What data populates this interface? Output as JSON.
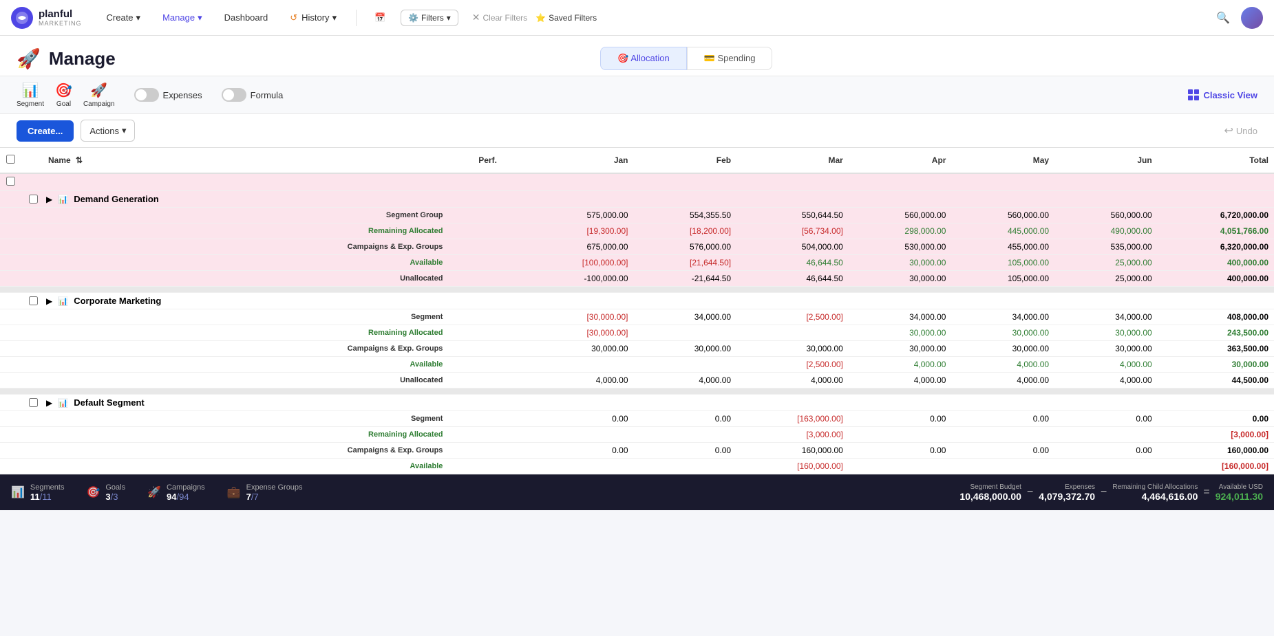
{
  "app": {
    "name": "planful",
    "subtitle": "MARKETING"
  },
  "nav": {
    "items": [
      {
        "label": "Create",
        "hasDropdown": true
      },
      {
        "label": "Manage",
        "hasDropdown": true
      },
      {
        "label": "Dashboard",
        "hasDropdown": false
      },
      {
        "label": "History",
        "hasDropdown": true,
        "icon": "history"
      }
    ],
    "filters_label": "Filters",
    "clear_filters": "Clear Filters",
    "saved_filters": "Saved Filters"
  },
  "page": {
    "title": "Manage",
    "tabs": [
      {
        "label": "Allocation",
        "icon": "🎯",
        "active": true
      },
      {
        "label": "Spending",
        "icon": "💰",
        "active": false
      }
    ]
  },
  "toolbar": {
    "segments_label": "Segment",
    "goals_label": "Goal",
    "campaigns_label": "Campaign",
    "expenses_label": "Expenses",
    "formula_label": "Formula",
    "classic_view": "Classic View"
  },
  "actions": {
    "create_label": "Create...",
    "actions_label": "Actions",
    "undo_label": "Undo"
  },
  "table": {
    "columns": [
      "Name",
      "Perf.",
      "Jan",
      "Feb",
      "Mar",
      "Apr",
      "May",
      "Jun",
      "Total"
    ],
    "rows": [
      {
        "group": "demand_generation",
        "name": "Demand Generation",
        "color": "pink",
        "sub_rows": [
          {
            "type": "segment_group",
            "label": "Segment Group",
            "jan": "575,000.00",
            "feb": "554,355.50",
            "mar": "550,644.50",
            "apr": "560,000.00",
            "may": "560,000.00",
            "jun": "560,000.00",
            "total": "6,720,000.00"
          },
          {
            "type": "remaining_allocated",
            "label": "Remaining Allocated",
            "jan": "[19,300.00]",
            "feb": "[18,200.00]",
            "mar": "[56,734.00]",
            "apr": "298,000.00",
            "may": "445,000.00",
            "jun": "490,000.00",
            "total": "4,051,766.00",
            "jan_color": "red",
            "feb_color": "red",
            "mar_color": "red",
            "apr_color": "green",
            "may_color": "green",
            "jun_color": "green",
            "total_color": "green"
          },
          {
            "type": "campaigns",
            "label": "Campaigns & Exp. Groups",
            "jan": "675,000.00",
            "feb": "576,000.00",
            "mar": "504,000.00",
            "apr": "530,000.00",
            "may": "455,000.00",
            "jun": "535,000.00",
            "total": "6,320,000.00"
          },
          {
            "type": "available",
            "label": "Available",
            "jan": "[100,000.00]",
            "feb": "[21,644.50]",
            "mar": "46,644.50",
            "apr": "30,000.00",
            "may": "105,000.00",
            "jun": "25,000.00",
            "total": "400,000.00",
            "jan_color": "red",
            "feb_color": "red",
            "mar_color": "green",
            "apr_color": "green",
            "may_color": "green",
            "jun_color": "green",
            "total_color": "green"
          },
          {
            "type": "unallocated",
            "label": "Unallocated",
            "jan": "-100,000.00",
            "feb": "-21,644.50",
            "mar": "46,644.50",
            "apr": "30,000.00",
            "may": "105,000.00",
            "jun": "25,000.00",
            "total": "400,000.00"
          }
        ]
      },
      {
        "group": "corporate_marketing",
        "name": "Corporate Marketing",
        "color": "white",
        "sub_rows": [
          {
            "type": "segment",
            "label": "Segment",
            "jan": "[30,000.00]",
            "feb": "34,000.00",
            "mar": "[2,500.00]",
            "apr": "34,000.00",
            "may": "34,000.00",
            "jun": "34,000.00",
            "total": "408,000.00",
            "jan_color": "red",
            "mar_color": "red"
          },
          {
            "type": "remaining_allocated",
            "label": "Remaining Allocated",
            "jan": "[30,000.00]",
            "feb": "",
            "mar": "",
            "apr": "30,000.00",
            "may": "30,000.00",
            "jun": "30,000.00",
            "total": "243,500.00",
            "jan_color": "red",
            "apr_color": "green",
            "may_color": "green",
            "jun_color": "green",
            "total_color": "green"
          },
          {
            "type": "campaigns",
            "label": "Campaigns & Exp. Groups",
            "jan": "30,000.00",
            "feb": "30,000.00",
            "mar": "30,000.00",
            "apr": "30,000.00",
            "may": "30,000.00",
            "jun": "30,000.00",
            "total": "363,500.00"
          },
          {
            "type": "available",
            "label": "Available",
            "jan": "",
            "feb": "",
            "mar": "[2,500.00]",
            "apr": "4,000.00",
            "may": "4,000.00",
            "jun": "4,000.00",
            "total": "30,000.00",
            "mar_color": "red",
            "apr_color": "green",
            "may_color": "green",
            "jun_color": "green",
            "total_color": "green"
          },
          {
            "type": "unallocated",
            "label": "Unallocated",
            "jan": "4,000.00",
            "feb": "4,000.00",
            "mar": "4,000.00",
            "apr": "4,000.00",
            "may": "4,000.00",
            "jun": "4,000.00",
            "total": "44,500.00"
          }
        ]
      },
      {
        "group": "default_segment",
        "name": "Default Segment",
        "color": "white",
        "sub_rows": [
          {
            "type": "segment",
            "label": "Segment",
            "jan": "0.00",
            "feb": "0.00",
            "mar": "[163,000.00]",
            "apr": "0.00",
            "may": "0.00",
            "jun": "0.00",
            "total": "0.00",
            "mar_color": "red"
          },
          {
            "type": "remaining_allocated",
            "label": "Remaining Allocated",
            "jan": "",
            "feb": "",
            "mar": "[3,000.00]",
            "apr": "",
            "may": "",
            "jun": "",
            "total": "[3,000.00]",
            "mar_color": "red",
            "total_color": "red"
          },
          {
            "type": "campaigns",
            "label": "Campaigns & Exp. Groups",
            "jan": "0.00",
            "feb": "0.00",
            "mar": "160,000.00",
            "apr": "0.00",
            "may": "0.00",
            "jun": "0.00",
            "total": "160,000.00"
          },
          {
            "type": "available",
            "label": "Available",
            "jan": "",
            "feb": "",
            "mar": "[160,000.00]",
            "apr": "",
            "may": "",
            "jun": "",
            "total": "[160,000.00]",
            "mar_color": "red",
            "total_color": "red"
          }
        ]
      }
    ]
  },
  "bottom_bar": {
    "segments": {
      "label": "Segments",
      "value": "11",
      "total": "11"
    },
    "goals": {
      "label": "Goals",
      "value": "3",
      "total": "3"
    },
    "campaigns": {
      "label": "Campaigns",
      "value": "94",
      "total": "94"
    },
    "expense_groups": {
      "label": "Expense Groups",
      "value": "7",
      "total": "7"
    },
    "segment_budget_label": "Segment Budget",
    "segment_budget_value": "10,468,000.00",
    "expenses_label": "Expenses",
    "expenses_value": "4,079,372.70",
    "remaining_label": "Remaining Child Allocations",
    "remaining_value": "4,464,616.00",
    "available_label": "Available USD",
    "available_value": "924,011.30"
  }
}
